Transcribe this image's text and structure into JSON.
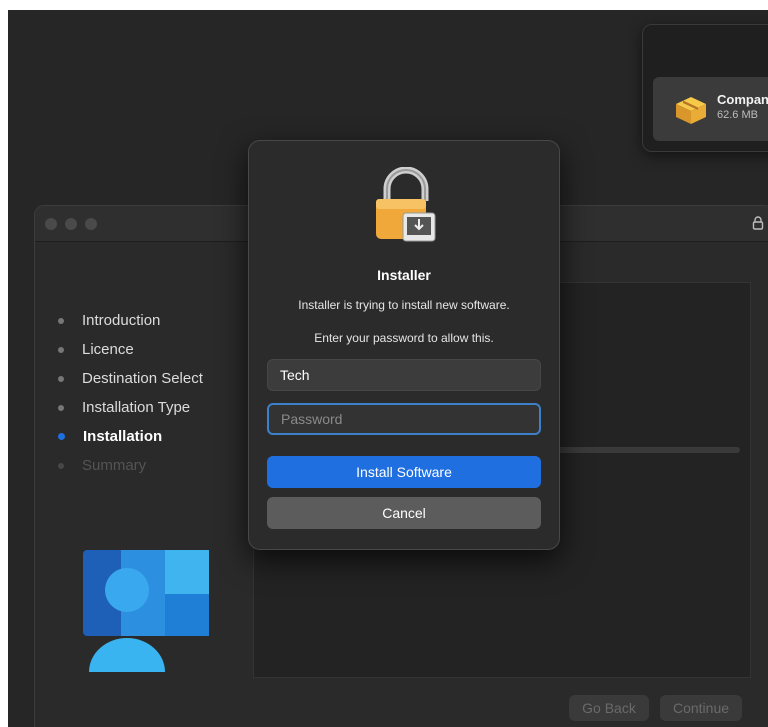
{
  "download_panel": {
    "file_name": "Compan",
    "file_size": "62.6 MB",
    "icon": "package-icon"
  },
  "installer": {
    "steps": [
      {
        "label": "Introduction",
        "state": "done"
      },
      {
        "label": "Licence",
        "state": "done"
      },
      {
        "label": "Destination Select",
        "state": "done"
      },
      {
        "label": "Installation Type",
        "state": "done"
      },
      {
        "label": "Installation",
        "state": "active"
      },
      {
        "label": "Summary",
        "state": "disabled"
      }
    ],
    "go_back_label": "Go Back",
    "continue_label": "Continue"
  },
  "auth_dialog": {
    "title": "Installer",
    "message": "Installer is trying to install new software.",
    "prompt": "Enter your password to allow this.",
    "username_value": "Tech",
    "password_placeholder": "Password",
    "install_label": "Install Software",
    "cancel_label": "Cancel"
  },
  "colors": {
    "accent": "#1f6fe0",
    "focus_ring": "#3d7fc9"
  }
}
